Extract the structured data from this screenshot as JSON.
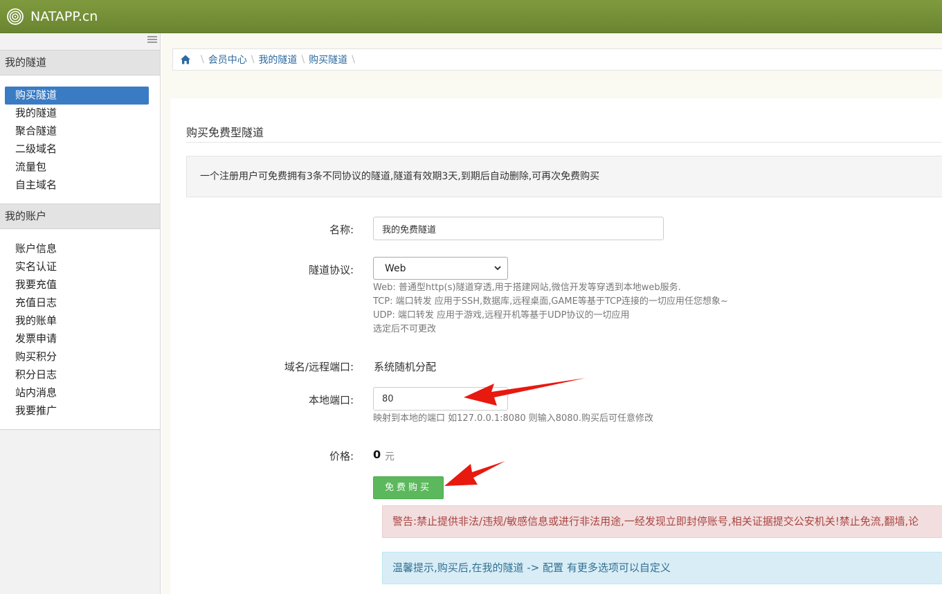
{
  "header": {
    "brand": "NATAPP.cn"
  },
  "sidebar": {
    "section1": "我的隧道",
    "items1": [
      "购买隧道",
      "我的隧道",
      "聚合隧道",
      "二级域名",
      "流量包",
      "自主域名"
    ],
    "section2": "我的账户",
    "items2": [
      "账户信息",
      "实名认证",
      "我要充值",
      "充值日志",
      "我的账单",
      "发票申请",
      "购买积分",
      "积分日志",
      "站内消息",
      "我要推广"
    ]
  },
  "breadcrumb": [
    "会员中心",
    "我的隧道",
    "购买隧道"
  ],
  "panel": {
    "title": "购买免费型隧道",
    "info": "一个注册用户可免费拥有3条不同协议的隧道,隧道有效期3天,到期后自动删除,可再次免费购买"
  },
  "form": {
    "name_label": "名称:",
    "name_value": "我的免费隧道",
    "protocol_label": "隧道协议:",
    "protocol_value": "Web",
    "protocol_help": [
      "Web: 普通型http(s)隧道穿透,用于搭建网站,微信开发等穿透到本地web服务.",
      "TCP: 端口转发 应用于SSH,数据库,远程桌面,GAME等基于TCP连接的一切应用任您想象~",
      "UDP: 端口转发 应用于游戏,远程开机等基于UDP协议的一切应用",
      "选定后不可更改"
    ],
    "domain_label": "域名/远程端口:",
    "domain_value": "系统随机分配",
    "local_port_label": "本地端口:",
    "local_port_value": "80",
    "local_port_help": "映射到本地的端口 如127.0.0.1:8080 则输入8080.购买后可任意修改",
    "price_label": "价格:",
    "price_value": "0",
    "price_unit": "元",
    "buy_button": "免费购买"
  },
  "alerts": {
    "warning": "警告:禁止提供非法/违规/敏感信息或进行非法用途,一经发现立即封停账号,相关证据提交公安机关!禁止免流,翻墙,论",
    "tip": "温馨提示,购买后,在我的隧道 -> 配置 有更多选项可以自定义"
  },
  "colors": {
    "topbar": "#7a963a",
    "active_item": "#3a7cc4",
    "buy_button": "#5cb85c",
    "arrow": "#e8190f"
  },
  "icons": {
    "logo": "spiral-logo-icon",
    "home": "home-icon",
    "menu": "menu-toggle-icon",
    "select": "chevron-down-icon"
  }
}
